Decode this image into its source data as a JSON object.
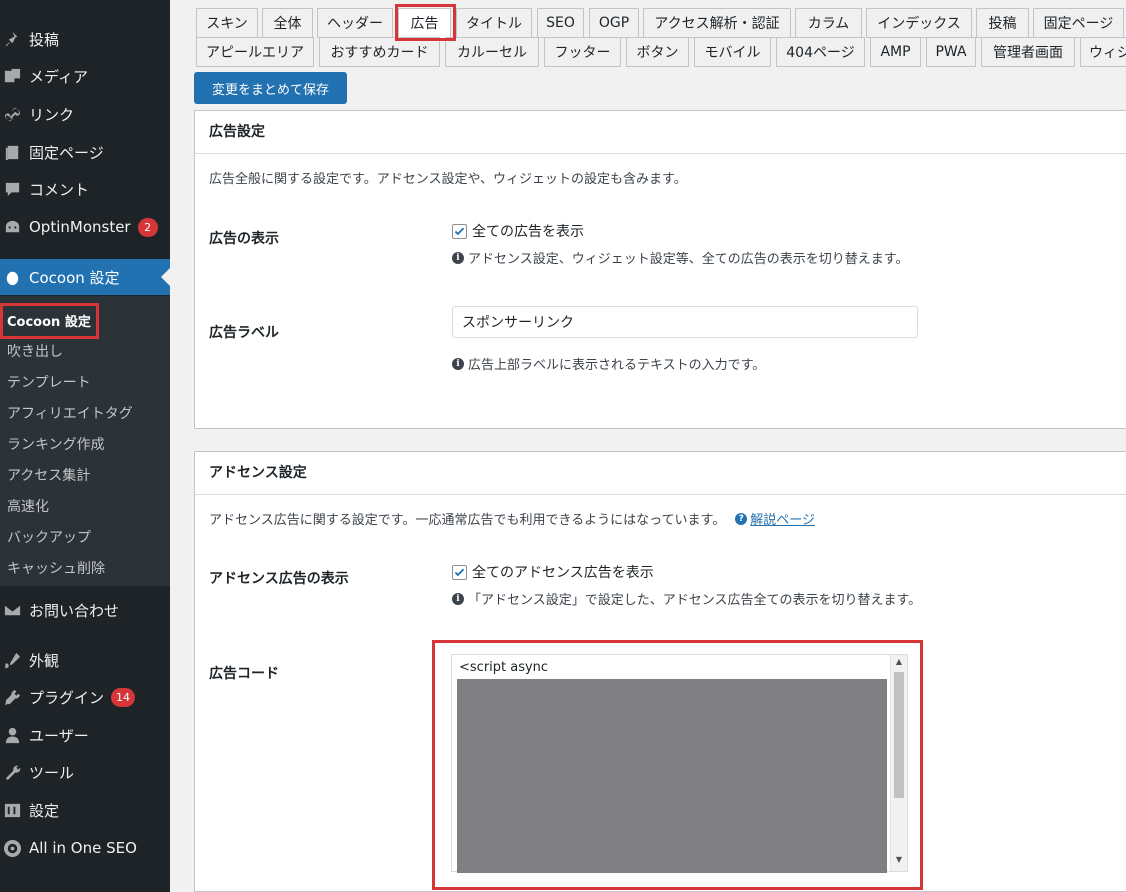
{
  "sidebar": {
    "menu": [
      {
        "label": "投稿",
        "icon": "pushpin-icon"
      },
      {
        "label": "メディア",
        "icon": "media-icon"
      },
      {
        "label": "リンク",
        "icon": "link-icon"
      },
      {
        "label": "固定ページ",
        "icon": "page-icon"
      },
      {
        "label": "コメント",
        "icon": "comment-icon"
      },
      {
        "label": "OptinMonster",
        "icon": "optinmonster-icon",
        "badge": "2"
      },
      {
        "label": "Cocoon 設定",
        "icon": "cocoon-icon"
      },
      {
        "label": "お問い合わせ",
        "icon": "mail-icon"
      },
      {
        "label": "外観",
        "icon": "appearance-icon"
      },
      {
        "label": "プラグイン",
        "icon": "plugin-icon",
        "badge": "14"
      },
      {
        "label": "ユーザー",
        "icon": "user-icon"
      },
      {
        "label": "ツール",
        "icon": "wrench-icon"
      },
      {
        "label": "設定",
        "icon": "settings-icon"
      },
      {
        "label": "All in One SEO",
        "icon": "aioseo-icon"
      }
    ],
    "submenu": [
      "Cocoon 設定",
      "吹き出し",
      "テンプレート",
      "アフィリエイトタグ",
      "ランキング作成",
      "アクセス集計",
      "高速化",
      "バックアップ",
      "キャッシュ削除"
    ]
  },
  "tabs": {
    "row1": [
      "スキン",
      "全体",
      "ヘッダー",
      "広告",
      "タイトル",
      "SEO",
      "OGP",
      "アクセス解析・認証",
      "カラム",
      "インデックス",
      "投稿",
      "固定ページ"
    ],
    "row2": [
      "アピールエリア",
      "おすすめカード",
      "カルーセル",
      "フッター",
      "ボタン",
      "モバイル",
      "404ページ",
      "AMP",
      "PWA",
      "管理者画面",
      "ウィジ"
    ],
    "active": "広告"
  },
  "save_button": "変更をまとめて保存",
  "ad_settings": {
    "title": "広告設定",
    "description": "広告全般に関する設定です。アドセンス設定や、ウィジェットの設定も含みます。",
    "display_label": "広告の表示",
    "display_checkbox": "全ての広告を表示",
    "display_checked": true,
    "display_hint": "アドセンス設定、ウィジェット設定等、全ての広告の表示を切り替えます。",
    "ad_label_label": "広告ラベル",
    "ad_label_value": "スポンサーリンク",
    "ad_label_hint": "広告上部ラベルに表示されるテキストの入力です。"
  },
  "adsense_settings": {
    "title": "アドセンス設定",
    "description": "アドセンス広告に関する設定です。一応通常広告でも利用できるようにはなっています。",
    "help_link": "解説ページ",
    "display_label": "アドセンス広告の表示",
    "display_checkbox": "全てのアドセンス広告を表示",
    "display_checked": true,
    "display_hint": "「アドセンス設定」で設定した、アドセンス広告全ての表示を切り替えます。",
    "code_label": "広告コード",
    "code_value": "<script async"
  },
  "colors": {
    "sidebar_bg": "#1d2327",
    "submenu_bg": "#2c3338",
    "accent": "#2271b1",
    "badge": "#d63638",
    "highlight": "#d63638"
  }
}
